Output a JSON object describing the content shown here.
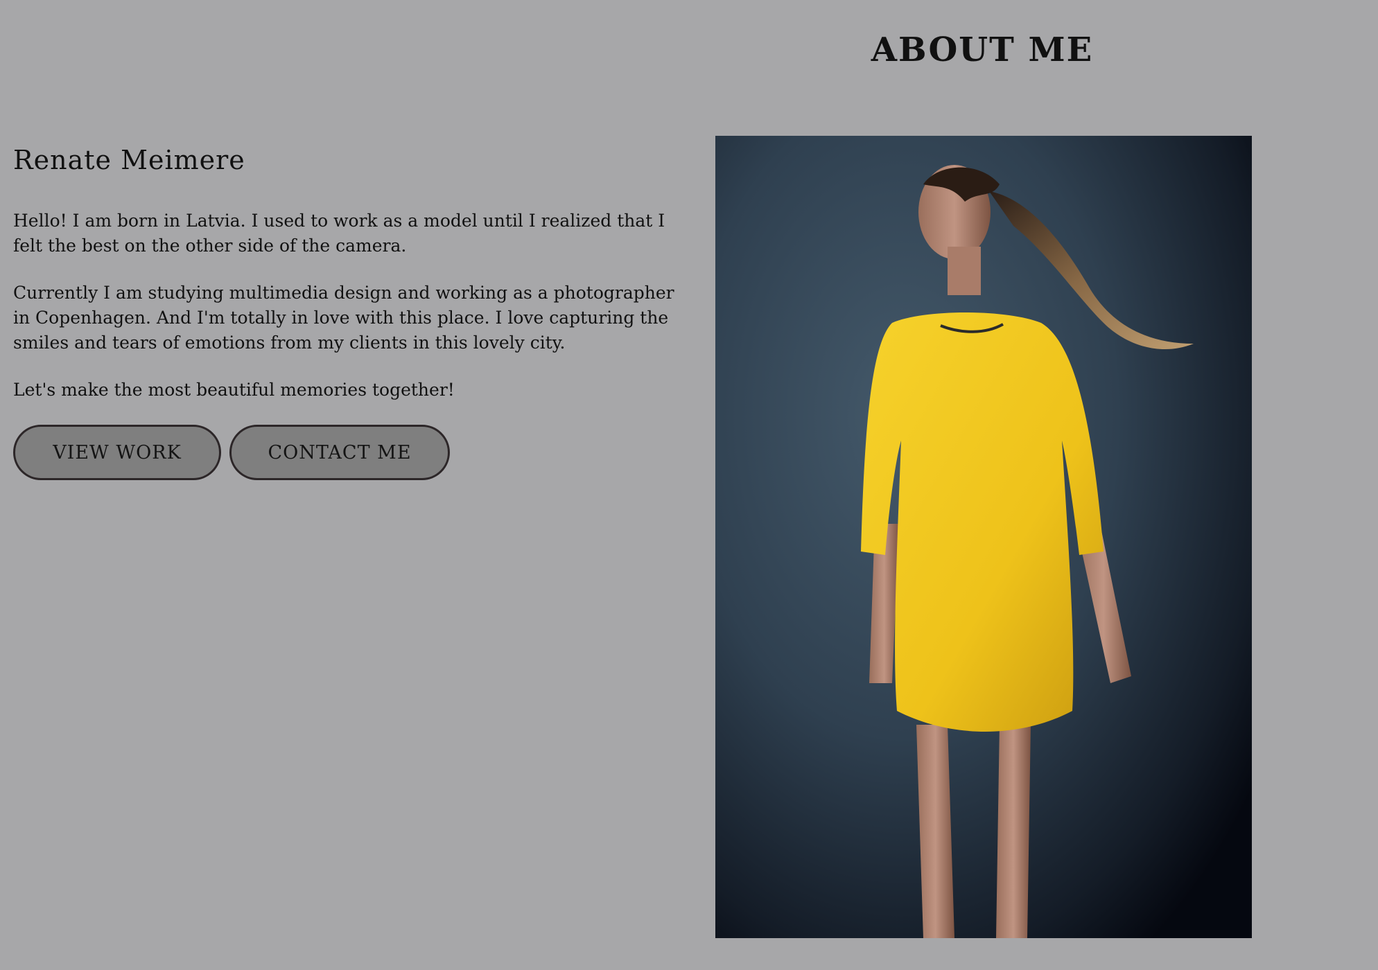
{
  "page": {
    "title": "ABOUT ME"
  },
  "intro": {
    "name": "Renate Meimere",
    "paragraphs": [
      "Hello! I am born in Latvia. I used to work as a model until I realized that I felt the best on the other side of the camera.",
      "Currently I am studying multimedia design and working as a photographer in Copenhagen. And I'm totally in love with this place. I love capturing the smiles and tears of emotions from my clients in this lovely city.",
      "Let's make the most beautiful memories together!"
    ]
  },
  "buttons": {
    "view_work": "VIEW WORK",
    "contact_me": "CONTACT ME"
  },
  "colors": {
    "background": "#a7a7a9",
    "button_fill": "#7f7f7f",
    "button_border": "#2c2628",
    "dress": "#f0c81e"
  }
}
